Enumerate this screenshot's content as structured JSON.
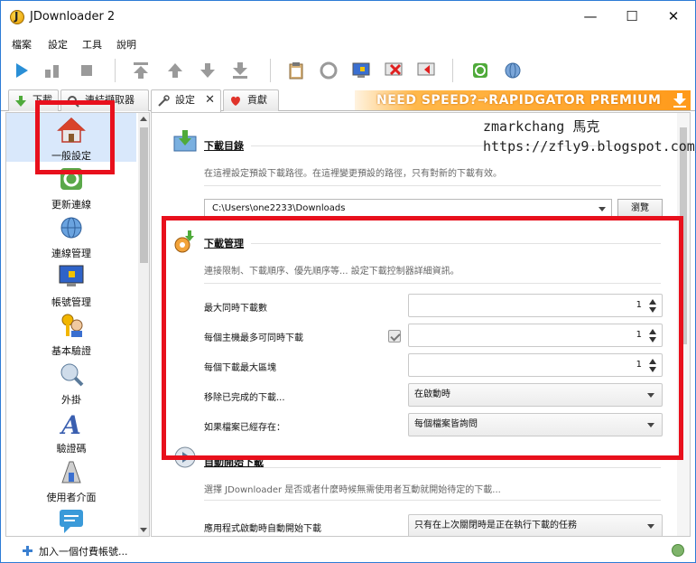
{
  "window": {
    "title": "JDownloader 2",
    "controls": [
      "—",
      "☐",
      "✕"
    ]
  },
  "menu": [
    "檔案",
    "設定",
    "工具",
    "說明"
  ],
  "tabs": [
    {
      "label": "下載",
      "closable": false
    },
    {
      "label": "連結擷取器",
      "closable": false
    },
    {
      "label": "設定",
      "closable": true,
      "close": "✕"
    },
    {
      "label": "貢獻",
      "closable": false
    }
  ],
  "banner": {
    "text": "NEED SPEED?→RAPIDGATOR PREMIUM"
  },
  "watermark": {
    "line1": "zmarkchang 馬克",
    "line2": "https://zfly9.blogspot.com/"
  },
  "sidebar": {
    "items": [
      {
        "label": "一般設定",
        "icon": "home-icon",
        "selected": true
      },
      {
        "label": "更新連線",
        "icon": "reconnect-icon",
        "selected": false
      },
      {
        "label": "連線管理",
        "icon": "connection-icon",
        "selected": false
      },
      {
        "label": "帳號管理",
        "icon": "account-icon",
        "selected": false
      },
      {
        "label": "基本驗證",
        "icon": "auth-icon",
        "selected": false
      },
      {
        "label": "外掛",
        "icon": "plugin-icon",
        "selected": false
      },
      {
        "label": "驗證碼",
        "icon": "captcha-icon",
        "selected": false
      },
      {
        "label": "使用者介面",
        "icon": "ui-icon",
        "selected": false
      },
      {
        "label": "",
        "icon": "chat-icon",
        "selected": false
      }
    ]
  },
  "download_folder": {
    "title": "下載目錄",
    "desc": "在這裡設定預設下載路徑。在這裡變更預設的路徑，只有對新的下載有效。",
    "path": "C:\\Users\\one2233\\Downloads",
    "browse_label": "瀏覽"
  },
  "download_management": {
    "title": "下載管理",
    "desc": "連接限制、下載順序、優先順序等... 設定下載控制器詳細資訊。",
    "rows": [
      {
        "label": "最大同時下載數",
        "value": "1"
      },
      {
        "label": "每個主機最多可同時下載",
        "value": "1",
        "checked": true
      },
      {
        "label": "每個下載最大區塊",
        "value": "1"
      },
      {
        "label": "移除已完成的下載...",
        "select": "在啟動時"
      },
      {
        "label": "如果檔案已經存在：",
        "select": "每個檔案皆詢問"
      }
    ]
  },
  "auto_start": {
    "title": "自動開始下載",
    "desc": "選擇 JDownloader 是否或者什麼時候無需使用者互動就開始待定的下載...",
    "row_label": "應用程式啟動時自動開始下載",
    "select": "只有在上次關閉時是正在執行下載的任務"
  },
  "status": {
    "text": "加入一個付費帳號..."
  },
  "colors": {
    "highlight": "#e8101c",
    "banner": "#ff9a1a",
    "selected": "#d9e8fb"
  }
}
